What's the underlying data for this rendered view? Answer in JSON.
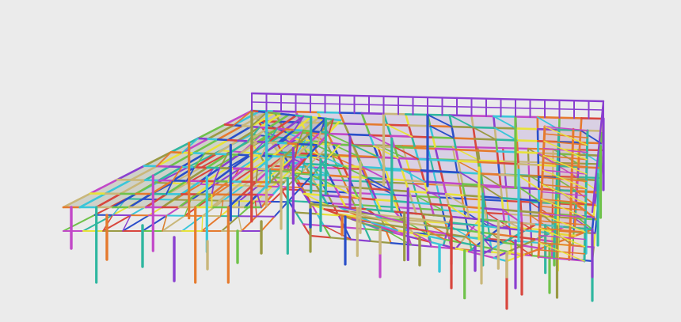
{
  "viewport": {
    "background": "#ebebeb",
    "content": "3d-steel-frame-model"
  },
  "model": {
    "colors": {
      "yellow": "#e8e23a",
      "purple": "#8a3fd0",
      "magenta": "#c248c8",
      "teal": "#2fb7a0",
      "cyan": "#39c6d9",
      "blue": "#2a4fc9",
      "orange": "#e57a2e",
      "green": "#6fc24a",
      "red": "#d8463d",
      "khaki": "#c9b77a",
      "olive": "#9a9a44"
    }
  }
}
